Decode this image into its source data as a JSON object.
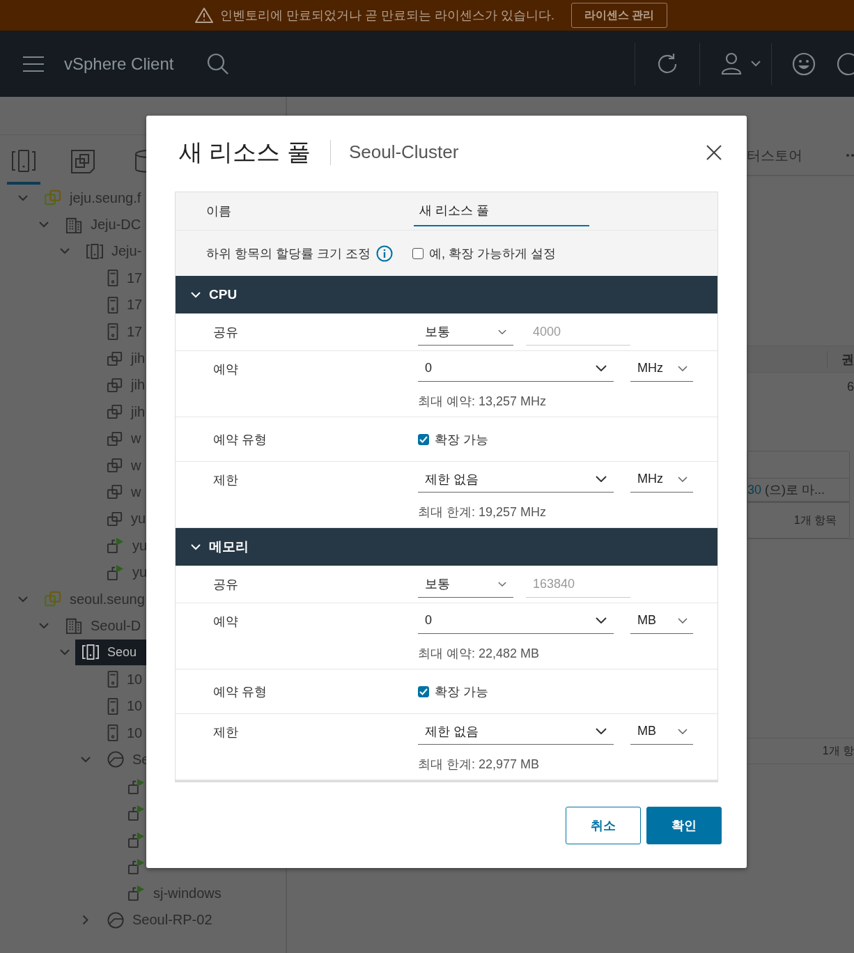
{
  "banner": {
    "message": "인벤토리에 만료되었거나 곧 만료되는 라이센스가 있습니다.",
    "button": "라이센스 관리"
  },
  "header": {
    "app_title": "vSphere Client"
  },
  "inventory_tabs": [
    {
      "kind": "hosts",
      "selected": true
    },
    {
      "kind": "vms",
      "selected": false
    },
    {
      "kind": "storage",
      "selected": false
    }
  ],
  "tree": [
    {
      "kind": "vcenter",
      "label": "jeju.seung.f",
      "expanded": true,
      "selected": false,
      "children": [
        {
          "kind": "datacenter",
          "label": "Jeju-DC",
          "expanded": true,
          "selected": false,
          "children": [
            {
              "kind": "cluster",
              "label": "Jeju-",
              "expanded": true,
              "selected": false,
              "children": [
                {
                  "kind": "host",
                  "label": "17",
                  "selected": false
                },
                {
                  "kind": "host",
                  "label": "17",
                  "selected": false
                },
                {
                  "kind": "host",
                  "label": "17",
                  "selected": false
                },
                {
                  "kind": "vm",
                  "label": "jih",
                  "selected": false
                },
                {
                  "kind": "vm",
                  "label": "jih",
                  "selected": false
                },
                {
                  "kind": "vm",
                  "label": "jih",
                  "selected": false
                },
                {
                  "kind": "vm",
                  "label": "w",
                  "selected": false
                },
                {
                  "kind": "vm",
                  "label": "w",
                  "selected": false
                },
                {
                  "kind": "vm",
                  "label": "w",
                  "selected": false
                },
                {
                  "kind": "vm",
                  "label": "yu",
                  "selected": false
                },
                {
                  "kind": "vm-on",
                  "label": "yu",
                  "selected": false
                },
                {
                  "kind": "vm-on",
                  "label": "yu",
                  "selected": false
                }
              ]
            }
          ]
        }
      ]
    },
    {
      "kind": "vcenter",
      "label": "seoul.seung",
      "expanded": true,
      "selected": false,
      "children": [
        {
          "kind": "datacenter",
          "label": "Seoul-D",
          "expanded": true,
          "selected": false,
          "children": [
            {
              "kind": "cluster",
              "label": "Seou",
              "expanded": true,
              "selected": true,
              "children": [
                {
                  "kind": "host",
                  "label": "10",
                  "selected": false
                },
                {
                  "kind": "host",
                  "label": "10",
                  "selected": false
                },
                {
                  "kind": "host",
                  "label": "10",
                  "selected": false
                },
                {
                  "kind": "pool",
                  "label": "Se",
                  "expanded": true,
                  "selected": false,
                  "children": [
                    {
                      "kind": "vm-on",
                      "selected": false
                    },
                    {
                      "kind": "vm-on",
                      "selected": false
                    },
                    {
                      "kind": "vm-on",
                      "selected": false
                    },
                    {
                      "kind": "vm-on",
                      "selected": false
                    },
                    {
                      "kind": "vm-on",
                      "label": "sj-windows",
                      "selected": false
                    }
                  ]
                },
                {
                  "kind": "pool",
                  "label": "Seoul-RP-02",
                  "expanded": false,
                  "selected": false
                }
              ]
            }
          ]
        }
      ]
    }
  ],
  "background": {
    "tab_label": "터스토어",
    "column_header": "권",
    "cell": "6",
    "link_text": "30",
    "message": " (으)로 마...",
    "item_count": "1개 항목",
    "item_count_2": "1개 항"
  },
  "dialog": {
    "title": "새 리소스 풀",
    "subtitle": "Seoul-Cluster",
    "name_field": {
      "label": "이름",
      "value": "새 리소스 풀",
      "focused": true
    },
    "scale_option": {
      "label": "하위 항목의 할당률 크기 조정",
      "checkbox_label": "예, 확장 가능하게 설정",
      "checked": false
    },
    "sections": [
      {
        "title": "CPU",
        "expanded": true,
        "rows": [
          {
            "kind": "shares",
            "label": "공유",
            "select": "보통",
            "value": "4000",
            "disabled": true
          },
          {
            "kind": "amount",
            "label": "예약",
            "value": "0",
            "unit": "MHz",
            "hint": "최대 예약: 13,257 MHz"
          },
          {
            "kind": "checkbox",
            "label": "예약 유형",
            "checkbox_label": "확장 가능",
            "checked": true
          },
          {
            "kind": "amount",
            "label": "제한",
            "value": "제한 없음",
            "unit": "MHz",
            "hint": "최대 한계: 19,257 MHz"
          }
        ]
      },
      {
        "title": "메모리",
        "expanded": true,
        "rows": [
          {
            "kind": "shares",
            "label": "공유",
            "select": "보통",
            "value": "163840",
            "disabled": true
          },
          {
            "kind": "amount",
            "label": "예약",
            "value": "0",
            "unit": "MB",
            "hint": "최대 예약: 22,482 MB"
          },
          {
            "kind": "checkbox",
            "label": "예약 유형",
            "checkbox_label": "확장 가능",
            "checked": true
          },
          {
            "kind": "amount",
            "label": "제한",
            "value": "제한 없음",
            "unit": "MB",
            "hint": "최대 한계: 22,977 MB"
          }
        ]
      }
    ],
    "buttons": [
      {
        "label": "취소",
        "kind": "secondary"
      },
      {
        "label": "확인",
        "kind": "primary"
      }
    ]
  }
}
